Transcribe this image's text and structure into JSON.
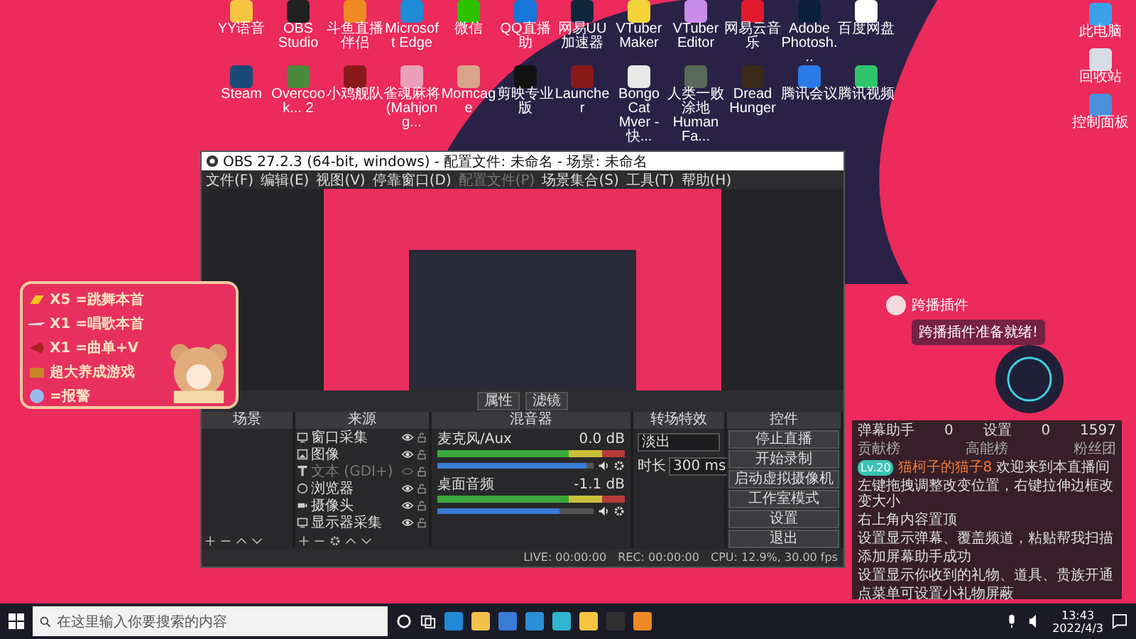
{
  "desktop": {
    "icons_top": [
      {
        "label": "YY语音",
        "color": "#f5c542"
      },
      {
        "label": "OBS Studio",
        "color": "#202020"
      },
      {
        "label": "斗鱼直播伴侣",
        "color": "#f08a24"
      },
      {
        "label": "Microsoft Edge",
        "color": "#1f8ad6"
      },
      {
        "label": "微信",
        "color": "#2dc100"
      },
      {
        "label": "QQ直播助",
        "color": "#1477d9"
      },
      {
        "label": "网易UU加速器",
        "color": "#10263d"
      },
      {
        "label": "VTuber Maker",
        "color": "#f2d43a"
      },
      {
        "label": "VTuber Editor",
        "color": "#c98de8"
      },
      {
        "label": "网易云音乐",
        "color": "#e01a2b"
      },
      {
        "label": "Adobe Photosh...",
        "color": "#0a1f3c"
      },
      {
        "label": "百度网盘",
        "color": "#ffffff"
      }
    ],
    "icons_bottom": [
      {
        "label": "Steam",
        "color": "#1b4a7a"
      },
      {
        "label": "Overcook... 2",
        "color": "#4b8a3c"
      },
      {
        "label": "小鸡舰队",
        "color": "#8a1a1a"
      },
      {
        "label": "雀魂麻将 (Mahjong...",
        "color": "#e9a0b8"
      },
      {
        "label": "Momcage",
        "color": "#d9a48a"
      },
      {
        "label": "剪映专业版",
        "color": "#111111"
      },
      {
        "label": "Launcher",
        "color": "#8a1a1a"
      },
      {
        "label": "Bongo Cat Mver - 快...",
        "color": "#e9e9e9"
      },
      {
        "label": "人类一败涂地 Human Fa...",
        "color": "#5a6a5a"
      },
      {
        "label": "Dread Hunger",
        "color": "#3a2a1a"
      },
      {
        "label": "腾讯会议",
        "color": "#2a7be8"
      },
      {
        "label": "腾讯视频",
        "color": "#2fc46b"
      }
    ],
    "icons_right": [
      {
        "label": "此电脑",
        "color": "#3aa0e8"
      },
      {
        "label": "回收站",
        "color": "#d8dde5"
      },
      {
        "label": "控制面板",
        "color": "#4a90d9"
      }
    ]
  },
  "obs_window": {
    "title": "OBS 27.2.3 (64-bit, windows) - 配置文件: 未命名 - 场景: 未命名",
    "menu": [
      {
        "label": "文件(F)",
        "disabled": false
      },
      {
        "label": "编辑(E)",
        "disabled": false
      },
      {
        "label": "视图(V)",
        "disabled": false
      },
      {
        "label": "停靠窗口(D)",
        "disabled": false
      },
      {
        "label": "配置文件(P)",
        "disabled": true
      },
      {
        "label": "场景集合(S)",
        "disabled": false
      },
      {
        "label": "工具(T)",
        "disabled": false
      },
      {
        "label": "帮助(H)",
        "disabled": false
      }
    ],
    "preview_buttons": [
      "属性",
      "滤镜"
    ],
    "scenes": {
      "title": "场景"
    },
    "sources": {
      "title": "来源",
      "items": [
        {
          "name": "窗口采集",
          "kind": "window",
          "visible": true
        },
        {
          "name": "图像",
          "kind": "image",
          "visible": true
        },
        {
          "name": "文本 (GDI+)",
          "kind": "text",
          "visible": false
        },
        {
          "name": "浏览器",
          "kind": "browser",
          "visible": true
        },
        {
          "name": "摄像头",
          "kind": "camera",
          "visible": true
        },
        {
          "name": "显示器采集",
          "kind": "display",
          "visible": true
        }
      ]
    },
    "mixer": {
      "title": "混音器",
      "channels": [
        {
          "name": "麦克风/Aux",
          "reading": "0.0 dB",
          "level": 0.95
        },
        {
          "name": "桌面音频",
          "reading": "-1.1 dB",
          "level": 0.78
        }
      ]
    },
    "transitions": {
      "title": "转场特效",
      "type": "淡出",
      "duration_label": "时长",
      "duration": "300 ms"
    },
    "controls": {
      "title": "控件",
      "buttons": [
        "停止直播",
        "开始录制",
        "启动虚拟摄像机",
        "工作室模式",
        "设置",
        "退出"
      ]
    },
    "status_bar": {
      "live": "LIVE: 00:00:00",
      "rec": "REC: 00:00:00",
      "cpu": "CPU: 12.9%, 30.00 fps"
    }
  },
  "gift_overlay": {
    "items": [
      {
        "kind": "gold",
        "text": "X5 =跳舞本首"
      },
      {
        "kind": "plane",
        "text": "X1 =唱歌本首"
      },
      {
        "kind": "rocket",
        "text": "X1 =曲单+V"
      },
      {
        "kind": "treasure",
        "text": "超大养成游戏"
      },
      {
        "kind": "gem",
        "text": "=报警"
      }
    ]
  },
  "crossplay_overlay": {
    "title": "跨播插件",
    "message": "跨播插件准备就绪!"
  },
  "chat_panel": {
    "title": "弹幕助手",
    "stats": [
      "0",
      "0",
      "1597"
    ],
    "setting": "设置",
    "tabs": [
      "贡献榜",
      "高能榜",
      "粉丝团"
    ],
    "welcome": {
      "badge": "Lv.20",
      "user": "猫柯子的猫子8",
      "text": "欢迎来到本直播间"
    },
    "notes": [
      "左键拖拽调整改变位置，右键拉伸边框改变大小",
      "右上角内容置顶",
      "设置显示弹幕、覆盖频道，粘贴帮我扫描",
      "添加屏幕助手成功",
      "设置显示你收到的礼物、道具、贵族开通",
      "点菜单可设置小礼物屏蔽"
    ]
  },
  "taskbar": {
    "search_placeholder": "在这里输入你要搜索的内容",
    "time": "13:43",
    "date": "2022/4/3"
  }
}
